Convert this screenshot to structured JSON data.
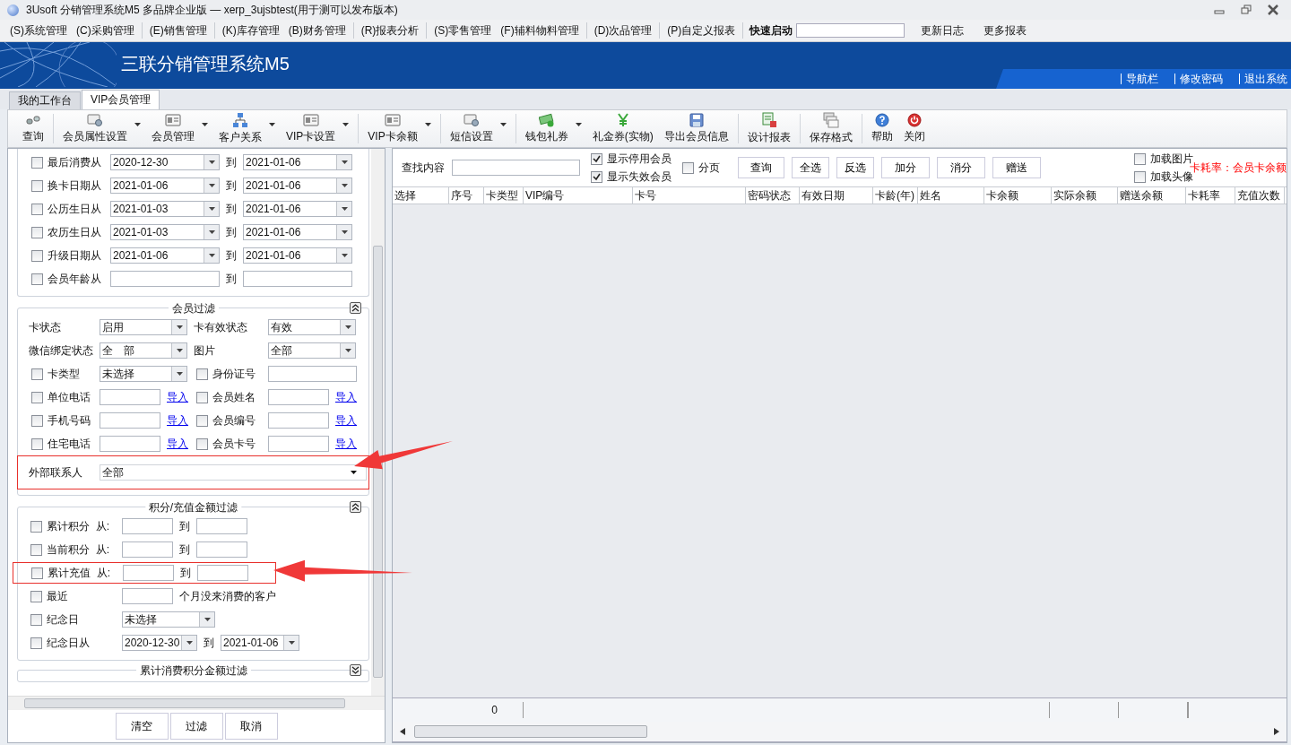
{
  "window": {
    "title": "3Usoft 分销管理系统M5 多品牌企业版 — xerp_3ujsbtest(用于测可以发布版本)"
  },
  "menu": {
    "groups": [
      [
        "(S)系统管理",
        "(C)采购管理"
      ],
      [
        "(E)销售管理"
      ],
      [
        "(K)库存管理",
        "(B)财务管理"
      ],
      [
        "(R)报表分析"
      ],
      [
        "(S)零售管理",
        "(F)辅料物料管理"
      ],
      [
        "(D)次品管理"
      ],
      [
        "(P)自定义报表"
      ]
    ],
    "quick_launch": {
      "label": "快速启动"
    },
    "links": [
      "更新日志",
      "更多报表"
    ]
  },
  "banner": {
    "title": "三联分销管理系统M5",
    "links": [
      "导航栏",
      "修改密码",
      "退出系统"
    ]
  },
  "tabs": [
    {
      "label": "我的工作台",
      "selected": false
    },
    {
      "label": "VIP会员管理",
      "selected": true
    }
  ],
  "toolbar": {
    "groups": [
      {
        "items": [
          {
            "label": "查询",
            "dropdown": false
          }
        ]
      },
      {
        "items": [
          {
            "label": "会员属性设置",
            "dropdown": true
          },
          {
            "label": "会员管理",
            "dropdown": true
          },
          {
            "label": "客户关系",
            "dropdown": true
          },
          {
            "label": "VIP卡设置",
            "dropdown": true
          }
        ]
      },
      {
        "items": [
          {
            "label": "VIP卡余额",
            "dropdown": true
          }
        ]
      },
      {
        "items": [
          {
            "label": "短信设置",
            "dropdown": true
          }
        ]
      },
      {
        "items": [
          {
            "label": "钱包礼券",
            "dropdown": true
          },
          {
            "label": "礼金券(实物)",
            "dropdown": false
          },
          {
            "label": "导出会员信息",
            "dropdown": false
          }
        ]
      },
      {
        "items": [
          {
            "label": "设计报表",
            "dropdown": false
          }
        ]
      },
      {
        "items": [
          {
            "label": "保存格式",
            "dropdown": false
          }
        ]
      },
      {
        "items": [
          {
            "label": "帮助",
            "dropdown": false
          },
          {
            "label": "关闭",
            "dropdown": false
          }
        ]
      }
    ]
  },
  "filter_panel": {
    "date_section": {
      "rows": [
        {
          "label": "最后消费从",
          "checked": false,
          "kind": "date_range",
          "from": "2020-12-30",
          "sep": "到",
          "to": "2021-01-06"
        },
        {
          "label": "换卡日期从",
          "checked": false,
          "kind": "date_range",
          "from": "2021-01-06",
          "sep": "到",
          "to": "2021-01-06"
        },
        {
          "label": "公历生日从",
          "checked": false,
          "kind": "date_range",
          "from": "2021-01-03",
          "sep": "到",
          "to": "2021-01-06"
        },
        {
          "label": "农历生日从",
          "checked": false,
          "kind": "date_range",
          "from": "2021-01-03",
          "sep": "到",
          "to": "2021-01-06"
        },
        {
          "label": "升级日期从",
          "checked": false,
          "kind": "date_range",
          "from": "2021-01-06",
          "sep": "到",
          "to": "2021-01-06"
        },
        {
          "label": "会员年龄从",
          "checked": false,
          "kind": "range",
          "sep": "到"
        }
      ]
    },
    "member_filter": {
      "title": "会员过滤",
      "expanded": true,
      "rows": [
        {
          "highlighted": false,
          "fields": [
            {
              "label": "卡状态",
              "kind": "select",
              "value": "启用"
            },
            {
              "label": "卡有效状态",
              "kind": "select",
              "value": "有效"
            }
          ]
        },
        {
          "highlighted": false,
          "fields": [
            {
              "label": "微信绑定状态",
              "kind": "select",
              "value": "全　部"
            },
            {
              "label": "图片",
              "kind": "select",
              "value": "全部"
            }
          ]
        },
        {
          "highlighted": false,
          "fields": [
            {
              "label": "卡类型",
              "checked": false,
              "kind": "select",
              "value": "未选择"
            },
            {
              "label": "身份证号",
              "checked": false,
              "kind": "wide_input"
            }
          ]
        },
        {
          "highlighted": false,
          "fields": [
            {
              "label": "单位电话",
              "checked": false,
              "kind": "input",
              "link": "导入"
            },
            {
              "label": "会员姓名",
              "checked": false,
              "kind": "input",
              "link": "导入"
            }
          ]
        },
        {
          "highlighted": false,
          "fields": [
            {
              "label": "手机号码",
              "checked": false,
              "kind": "input",
              "link": "导入"
            },
            {
              "label": "会员编号",
              "checked": false,
              "kind": "input",
              "link": "导入"
            }
          ]
        },
        {
          "highlighted": false,
          "fields": [
            {
              "label": "住宅电话",
              "checked": false,
              "kind": "input",
              "link": "导入"
            },
            {
              "label": "会员卡号",
              "checked": false,
              "kind": "input",
              "link": "导入"
            }
          ]
        },
        {
          "highlighted": true,
          "fields": [
            {
              "label": "外部联系人",
              "kind": "wide_select",
              "value": "全部"
            }
          ]
        }
      ]
    },
    "points_filter": {
      "title": "积分/充值金额过滤",
      "expanded": true,
      "rows": [
        {
          "label": "累计积分  从:",
          "checked": false,
          "highlighted": false,
          "kind": "range",
          "sep": "到"
        },
        {
          "label": "当前积分  从:",
          "checked": false,
          "highlighted": false,
          "kind": "range",
          "sep": "到"
        },
        {
          "label": "累计充值  从:",
          "checked": false,
          "highlighted": true,
          "kind": "range",
          "sep": "到"
        },
        {
          "label": "最近",
          "checked": false,
          "highlighted": false,
          "kind": "months",
          "suffix": "个月没来消费的客户"
        },
        {
          "label": "纪念日",
          "checked": false,
          "highlighted": false,
          "kind": "select",
          "value": "未选择"
        },
        {
          "label": "纪念日从",
          "checked": false,
          "highlighted": false,
          "kind": "date_range",
          "from": "2020-12-30",
          "sep": "到",
          "to": "2021-01-06"
        }
      ]
    },
    "consumption_filter": {
      "title": "累计消费积分金额过滤",
      "expanded": false
    },
    "buttons": [
      "清空",
      "过滤",
      "取消"
    ]
  },
  "results": {
    "search": {
      "label": "查找内容"
    },
    "options": [
      {
        "label": "显示停用会员",
        "checked": true
      },
      {
        "label": "显示失效会员",
        "checked": true
      }
    ],
    "paging": {
      "label": "分页",
      "checked": false
    },
    "buttons": [
      "查询",
      "全选",
      "反选",
      "加分",
      "消分",
      "赠送"
    ],
    "load_options": [
      {
        "label": "加载图片",
        "checked": false
      },
      {
        "label": "加载头像",
        "checked": false
      }
    ],
    "note": "卡耗率：会员卡余额",
    "table": {
      "columns": [
        "选择",
        "序号",
        "卡类型",
        "VIP编号",
        "卡号",
        "密码状态",
        "有效日期",
        "卡龄(年)",
        "姓名",
        "卡余额",
        "实际余额",
        "赠送余额",
        "卡耗率",
        "充值次数"
      ]
    },
    "summary": {
      "count": "0"
    }
  }
}
